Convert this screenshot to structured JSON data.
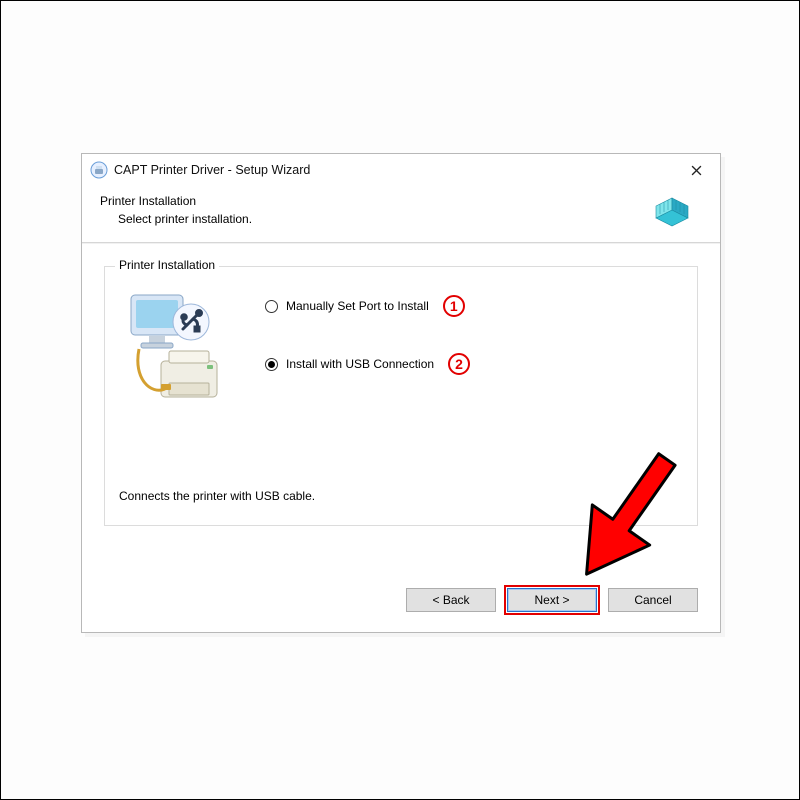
{
  "window": {
    "title": "CAPT Printer Driver - Setup Wizard"
  },
  "header": {
    "title": "Printer Installation",
    "subtitle": "Select printer installation."
  },
  "group": {
    "legend": "Printer Installation",
    "option1": "Manually Set Port to Install",
    "option2": "Install with USB Connection",
    "status": "Connects the printer with USB cable."
  },
  "buttons": {
    "back": "< Back",
    "next": "Next >",
    "cancel": "Cancel"
  },
  "annot": {
    "one": "1",
    "two": "2"
  }
}
